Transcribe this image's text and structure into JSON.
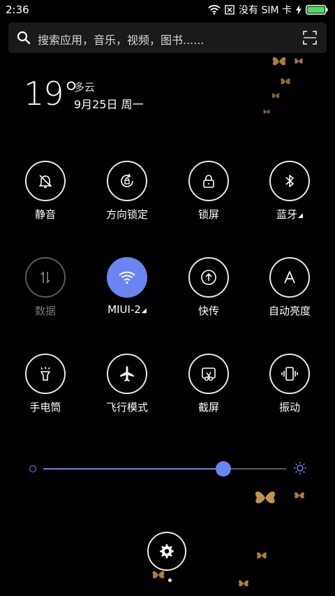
{
  "status_bar": {
    "time": "2:36",
    "sim_text": "没有 SIM 卡",
    "icons": [
      "wifi-icon",
      "no-sim-icon",
      "charging-icon",
      "battery-icon"
    ],
    "battery_level": 1.0
  },
  "search": {
    "placeholder": "搜索应用，音乐，视频，图书......",
    "icons": [
      "search-icon",
      "scan-icon"
    ]
  },
  "weather": {
    "temperature": "19°",
    "condition": "多云",
    "date": "9月25日 周一"
  },
  "toggles": [
    {
      "label": "静音",
      "icon": "bell-off-icon",
      "state": "off"
    },
    {
      "label": "方向锁定",
      "icon": "rotation-lock-icon",
      "state": "off"
    },
    {
      "label": "锁屏",
      "icon": "lock-icon",
      "state": "off"
    },
    {
      "label": "蓝牙",
      "icon": "bluetooth-icon",
      "state": "off",
      "expandable": true
    },
    {
      "label": "数据",
      "icon": "mobile-data-icon",
      "state": "disabled"
    },
    {
      "label": "MIUI-2",
      "icon": "wifi-icon",
      "state": "active",
      "expandable": true
    },
    {
      "label": "快传",
      "icon": "quick-transfer-icon",
      "state": "off"
    },
    {
      "label": "自动亮度",
      "icon": "auto-brightness-icon",
      "state": "off"
    },
    {
      "label": "手电筒",
      "icon": "flashlight-icon",
      "state": "off"
    },
    {
      "label": "飞行模式",
      "icon": "airplane-icon",
      "state": "off"
    },
    {
      "label": "截屏",
      "icon": "screenshot-icon",
      "state": "off"
    },
    {
      "label": "振动",
      "icon": "vibrate-icon",
      "state": "off"
    }
  ],
  "brightness": {
    "level": 0.74,
    "icons": [
      "brightness-low-icon",
      "brightness-high-icon"
    ]
  },
  "settings": {
    "icon": "gear-icon"
  },
  "colors": {
    "accent": "#6a84f2",
    "background": "#000000",
    "tile_border": "#e8e8e8",
    "disabled": "#5a5a5a"
  }
}
